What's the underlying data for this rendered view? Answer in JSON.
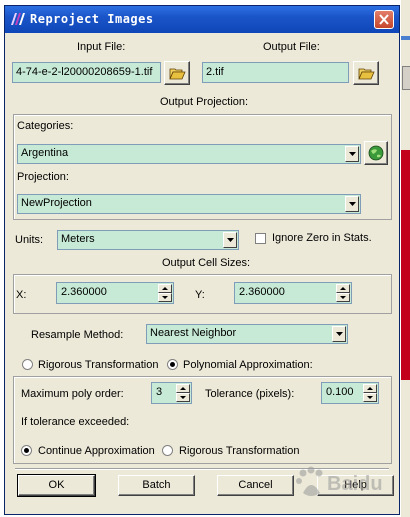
{
  "window": {
    "title": "Reproject Images"
  },
  "input_file": {
    "label": "Input File:",
    "value": "4-74-e-2-l20000208659-1.tif"
  },
  "output_file": {
    "label": "Output File:",
    "value": "2.tif"
  },
  "output_projection": {
    "label": "Output Projection:"
  },
  "categories": {
    "label": "Categories:",
    "value": "Argentina"
  },
  "projection": {
    "label": "Projection:",
    "value": "NewProjection"
  },
  "units": {
    "label": "Units:",
    "value": "Meters"
  },
  "ignore_zero": {
    "label": "Ignore Zero in Stats.",
    "checked": false
  },
  "cell_sizes": {
    "label": "Output Cell Sizes:",
    "x_label": "X:",
    "x_value": "2.360000",
    "y_label": "Y:",
    "y_value": "2.360000"
  },
  "resample": {
    "label": "Resample Method:",
    "value": "Nearest Neighbor"
  },
  "transform": {
    "rigorous_label": "Rigorous Transformation",
    "polynomial_label": "Polynomial Approximation:",
    "selected": "polynomial"
  },
  "poly": {
    "order_label": "Maximum poly order:",
    "order_value": "3",
    "tolerance_label": "Tolerance (pixels):",
    "tolerance_value": "0.100"
  },
  "exceeded": {
    "label": "If tolerance exceeded:",
    "continue_label": "Continue Approximation",
    "rigorous_label": "Rigorous Transformation",
    "selected": "continue"
  },
  "buttons": {
    "ok": "OK",
    "batch": "Batch",
    "cancel": "Cancel",
    "help": "Help"
  },
  "watermark": {
    "text": "Baidu"
  },
  "icons": [
    "app-icon",
    "close-icon",
    "folder-open-icon",
    "globe-icon",
    "chevron-down-icon",
    "spin-up-icon",
    "spin-down-icon"
  ]
}
